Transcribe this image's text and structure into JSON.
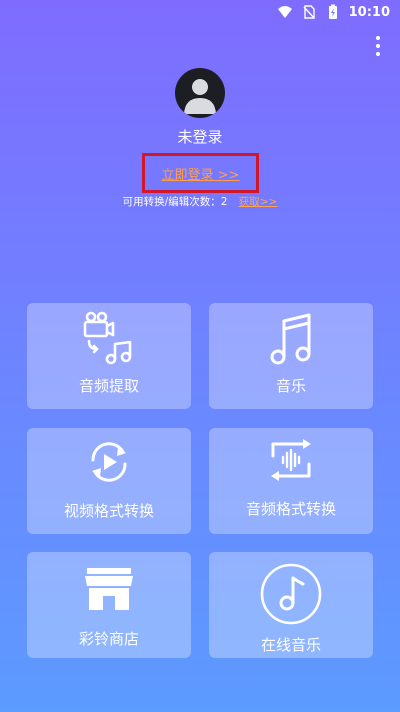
{
  "status": {
    "time": "10:10"
  },
  "profile": {
    "username": "未登录"
  },
  "login": {
    "link_text": "立即登录 >>"
  },
  "usage": {
    "text": "可用转换/编辑次数：2",
    "get_link": "获取>>"
  },
  "cards": [
    {
      "label": "音频提取",
      "icon": "video-to-music-icon"
    },
    {
      "label": "音乐",
      "icon": "music-note-icon"
    },
    {
      "label": "视频格式转换",
      "icon": "video-rotate-icon"
    },
    {
      "label": "音频格式转换",
      "icon": "audio-convert-icon"
    },
    {
      "label": "彩铃商店",
      "icon": "store-icon"
    },
    {
      "label": "在线音乐",
      "icon": "music-disc-icon"
    }
  ]
}
